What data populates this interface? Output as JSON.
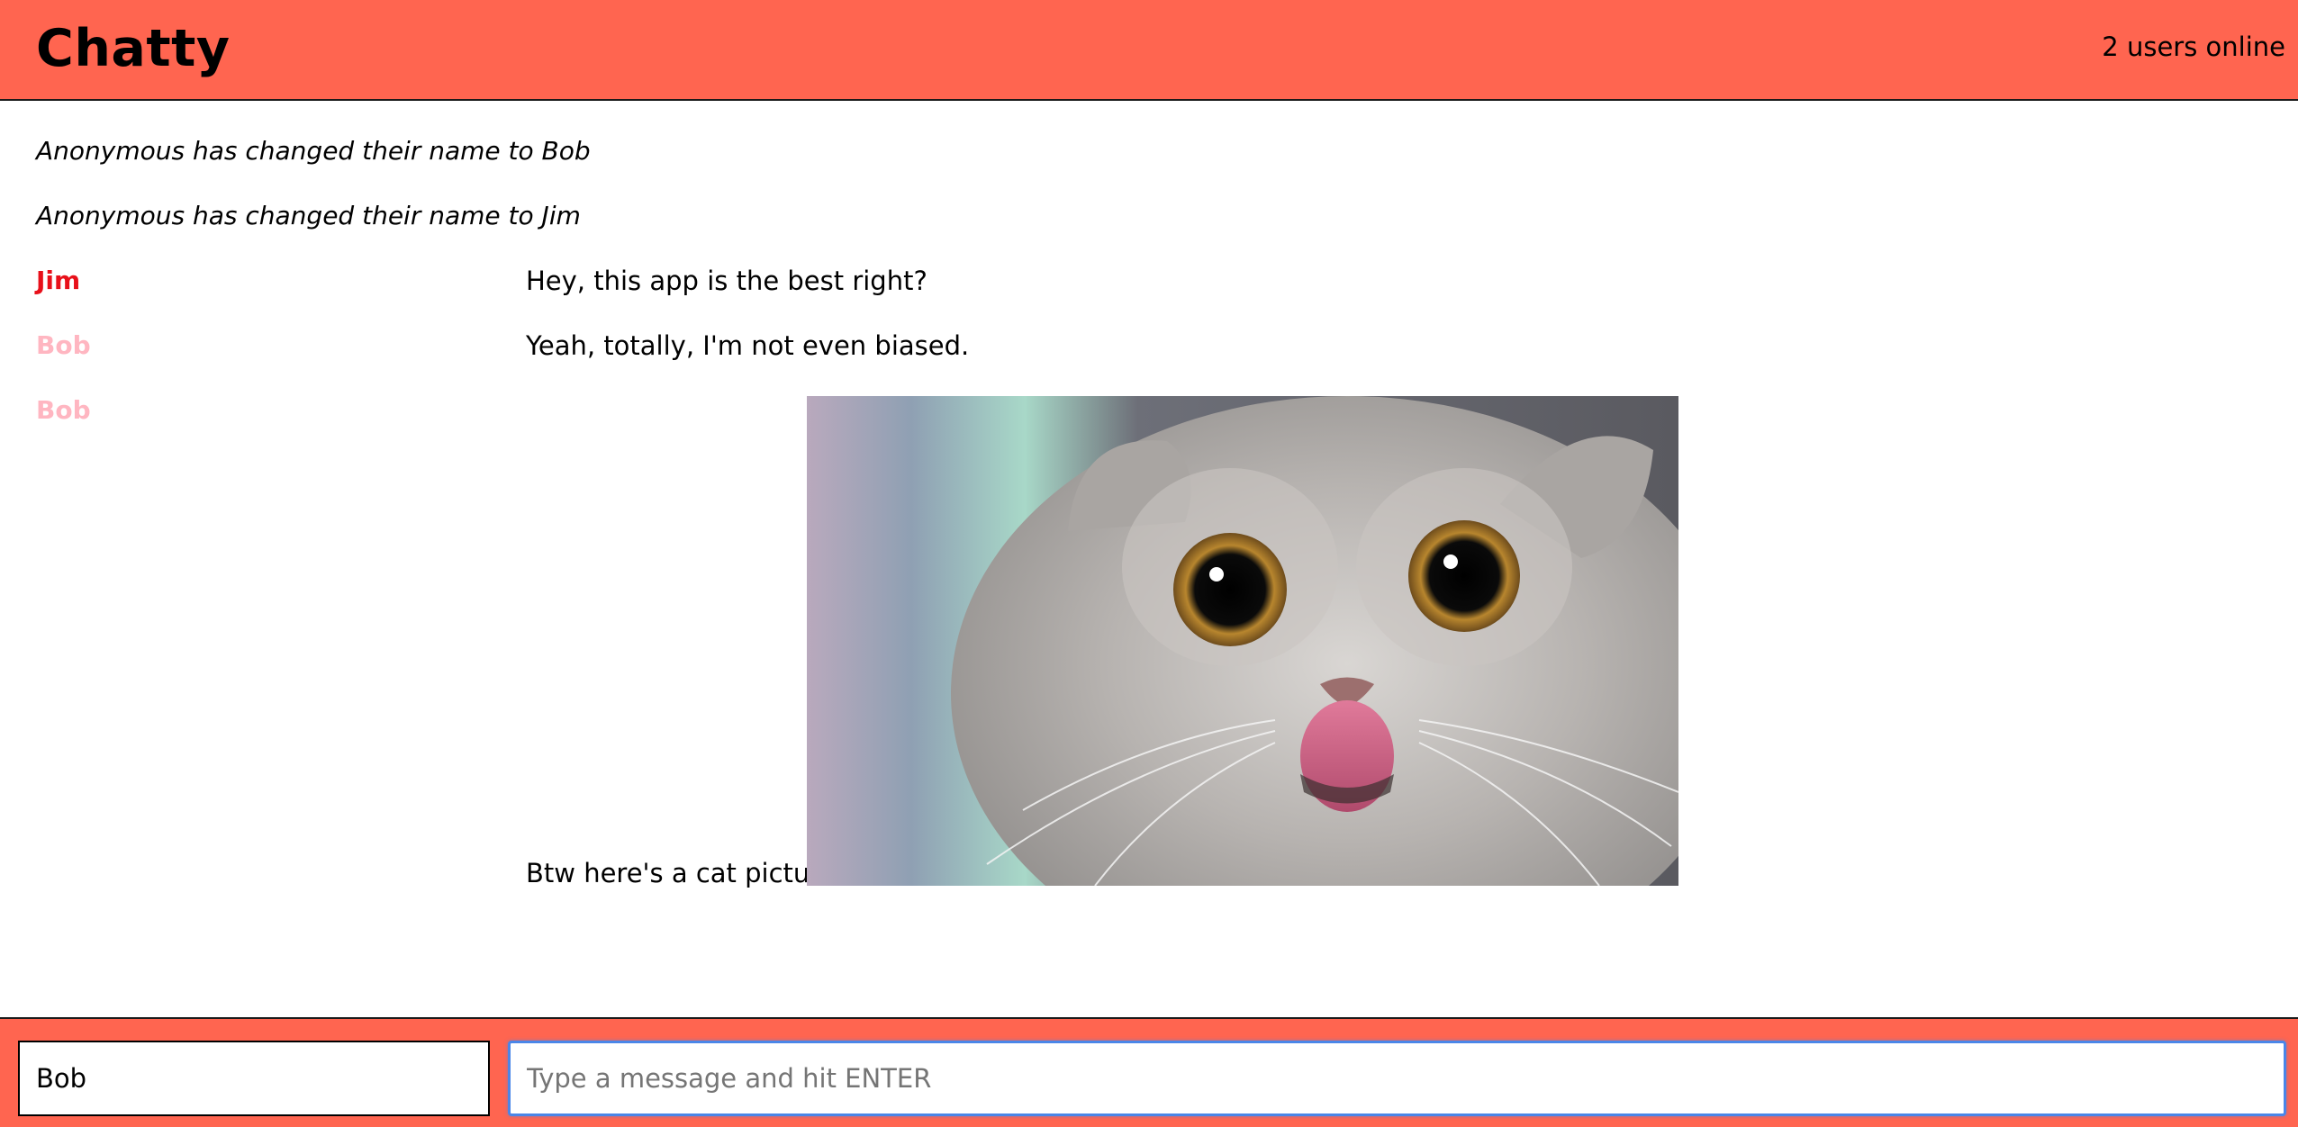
{
  "navbar": {
    "brand": "Chatty",
    "users_online": "2 users online",
    "background_color": "#ff6550"
  },
  "messages": {
    "system": [
      "Anonymous has changed their name to Bob",
      "Anonymous has changed their name to Jim"
    ],
    "chat": [
      {
        "username": "Jim",
        "username_color": "#e8101a",
        "content": "Hey, this app is the best right?"
      },
      {
        "username": "Bob",
        "username_color": "#ffb6c1",
        "content": "Yeah, totally, I'm not even biased."
      },
      {
        "username": "Bob",
        "username_color": "#ffb6c1",
        "content": "Btw here's a cat picture",
        "image": "cat-picture"
      }
    ]
  },
  "footer": {
    "name_value": "Bob",
    "message_value": "",
    "message_placeholder": "Type a message and hit ENTER"
  }
}
